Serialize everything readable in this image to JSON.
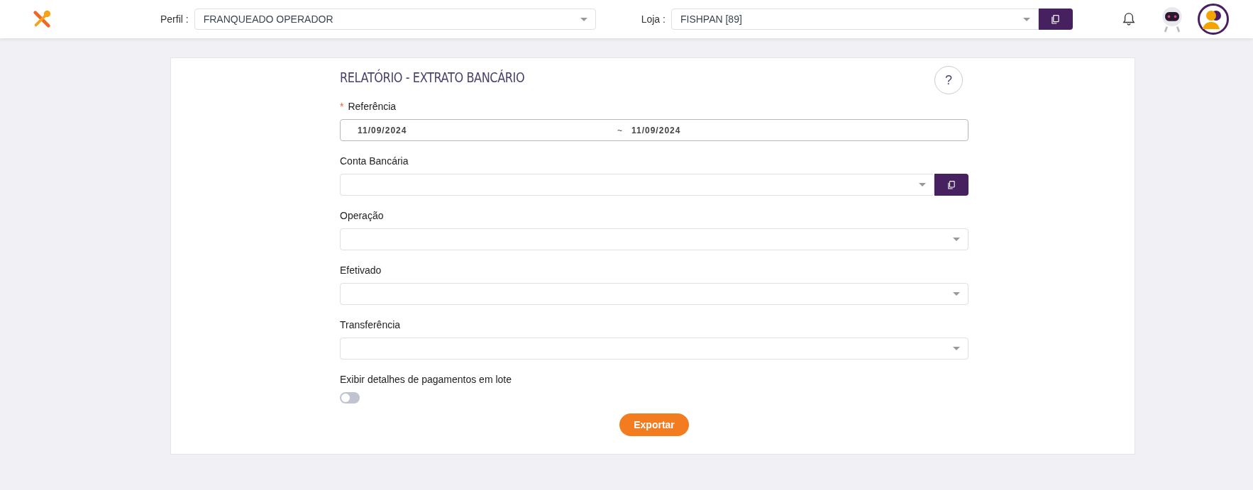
{
  "header": {
    "profile": {
      "label": "Perfil :",
      "value": "FRANQUEADO OPERADOR"
    },
    "store": {
      "label": "Loja :",
      "value": "FISHPAN [89]"
    }
  },
  "report": {
    "title": "RELATÓRIO - EXTRATO BANCÁRIO",
    "help": "?",
    "fields": [
      {
        "kind": "date-range",
        "label": "Referência",
        "required": true,
        "required_mark": "*",
        "start": "11/09/2024",
        "separator": "~",
        "end": "11/09/2024"
      },
      {
        "kind": "select-copy",
        "label": "Conta Bancária",
        "required": false
      },
      {
        "kind": "select",
        "label": "Operação",
        "required": false
      },
      {
        "kind": "select",
        "label": "Efetivado",
        "required": false
      },
      {
        "kind": "select",
        "label": "Transferência",
        "required": false
      }
    ],
    "toggle": {
      "label": "Exibir detalhes de pagamentos em lote",
      "on": false
    },
    "export_button": "Exportar"
  }
}
